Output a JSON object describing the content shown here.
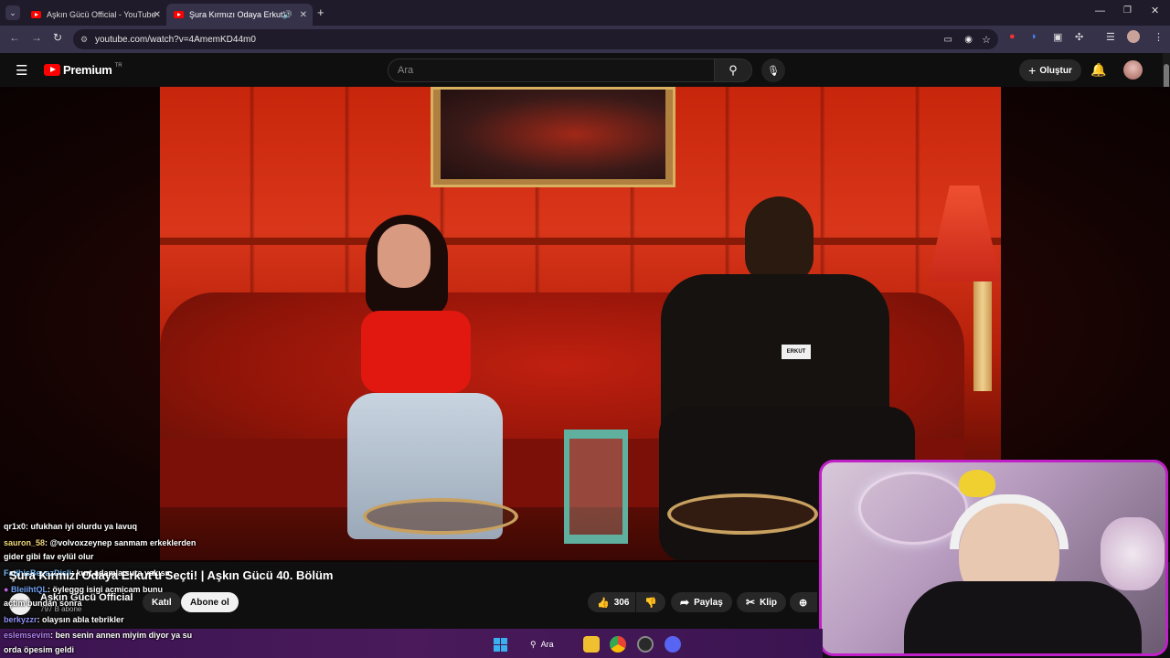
{
  "browser": {
    "tabs": [
      {
        "title": "Aşkın Gücü Official - YouTube"
      },
      {
        "title": "Şura Kırmızı Odaya Erkut'u"
      }
    ],
    "url": "youtube.com/watch?v=4AmemKD44m0"
  },
  "youtube": {
    "logo": "Premium",
    "region": "TR",
    "search_placeholder": "Ara",
    "create_label": "Oluştur"
  },
  "video": {
    "title": "Şura Kırmızı Odaya Erkut'u Seçti! | Aşkın Gücü 40. Bölüm",
    "channel": "Aşkın Gücü Official",
    "subscribers": "797 B abone",
    "join_label": "Katıl",
    "subscribe_label": "Abone ol",
    "likes": "306",
    "share_label": "Paylaş",
    "clip_label": "Klip",
    "tag_label": "ERKUT"
  },
  "chat": [
    {
      "user": "qr1x0",
      "msg": ": ufukhan iyi olurdu ya lavuq"
    },
    {
      "user": "sauron_58",
      "msg": ": @volvoxzeynep sanmam erkeklerden"
    },
    {
      "user": "",
      "msg": "gider gibi fav eylül olur"
    },
    {
      "user": "FatihisBeyazDisli",
      "msg": ": kurt adamla sura yakısır"
    },
    {
      "user": "BleiihtQL",
      "msg": ": öyleggg isigi acmicam bunu"
    },
    {
      "user": "",
      "msg": "açtım bundan sonra"
    },
    {
      "user": "berkyzzr",
      "msg": ": olaysın abla tebrikler"
    },
    {
      "user": "eslemsevim",
      "msg": ": ben senin annen miyim diyor ya su"
    },
    {
      "user": "",
      "msg": "orda öpesim geldi"
    }
  ],
  "taskbar": {
    "search_label": "Ara"
  },
  "colors": {
    "accent": "#ff0000",
    "cam_border": "#c020c8"
  }
}
